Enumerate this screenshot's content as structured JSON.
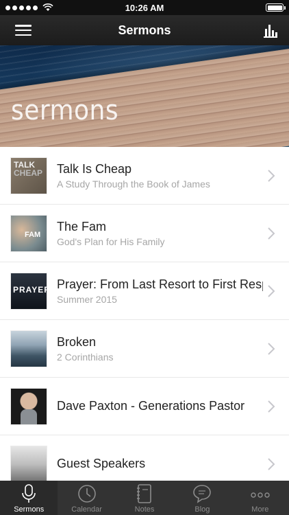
{
  "status_bar": {
    "time": "10:26 AM"
  },
  "nav": {
    "title": "Sermons"
  },
  "hero": {
    "text": "sermons"
  },
  "sermons": [
    {
      "title": "Talk Is Cheap",
      "subtitle": "A Study Through the Book of James",
      "thumb_text": "TALK CHEAP"
    },
    {
      "title": "The Fam",
      "subtitle": "God's Plan for His Family",
      "thumb_text": ""
    },
    {
      "title": "Prayer: From Last Resort to First Response",
      "subtitle": "Summer 2015",
      "thumb_text": "PRAYER"
    },
    {
      "title": "Broken",
      "subtitle": "2 Corinthians",
      "thumb_text": ""
    },
    {
      "title": "Dave Paxton - Generations Pastor",
      "subtitle": "",
      "thumb_text": ""
    },
    {
      "title": "Guest Speakers",
      "subtitle": "",
      "thumb_text": ""
    }
  ],
  "tabs": [
    {
      "label": "Sermons",
      "icon": "microphone-icon",
      "active": true
    },
    {
      "label": "Calendar",
      "icon": "clock-icon",
      "active": false
    },
    {
      "label": "Notes",
      "icon": "notebook-icon",
      "active": false
    },
    {
      "label": "Blog",
      "icon": "chat-bubble-icon",
      "active": false
    },
    {
      "label": "More",
      "icon": "more-dots-icon",
      "active": false
    }
  ]
}
